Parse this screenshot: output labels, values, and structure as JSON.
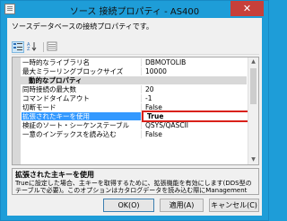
{
  "window": {
    "title": "ソース 接続プロパティ - AS400",
    "close_glyph": "✕"
  },
  "description": "ソースデータベースの接続プロパティです。",
  "toolbar": {
    "sort_category_icon": "sort-by-category-icon",
    "sort_alpha_icon": "sort-alphabetical-icon",
    "property_pages_icon": "property-pages-icon"
  },
  "grid": {
    "rows": [
      {
        "type": "prop",
        "name": "一時的なライブラリ名",
        "value": "DBMOTOLIB"
      },
      {
        "type": "prop",
        "name": "最大ミラーリングブロックサイズ",
        "value": "10000"
      },
      {
        "type": "category",
        "name": "動的なプロパティ",
        "toggle": "▲"
      },
      {
        "type": "prop",
        "name": "同時接続の最大数",
        "value": "20"
      },
      {
        "type": "prop",
        "name": "コマンドタイムアウト",
        "value": "-1"
      },
      {
        "type": "prop",
        "name": "切断モード",
        "value": "False"
      },
      {
        "type": "prop",
        "name": "拡張されたキーを使用",
        "value": "True",
        "selected": true
      },
      {
        "type": "prop",
        "name": "検証のソート・シーケンステーブル",
        "value": "QSYS/QASCII"
      },
      {
        "type": "prop",
        "name": "一意のインデックスを読み込む",
        "value": "False"
      }
    ],
    "dropdown_glyph": "⌄"
  },
  "help": {
    "title": "拡張された主キーを使用",
    "text": "Trueに設定した場合、主キーを取得するために、拡張機能を有効にします(DDS型のテーブルで必要)。このオプションはカタログデータを読み込む際にManagement Cent…"
  },
  "buttons": {
    "ok": "OK(O)",
    "apply": "適用(A)",
    "cancel": "キャンセル(C)"
  }
}
